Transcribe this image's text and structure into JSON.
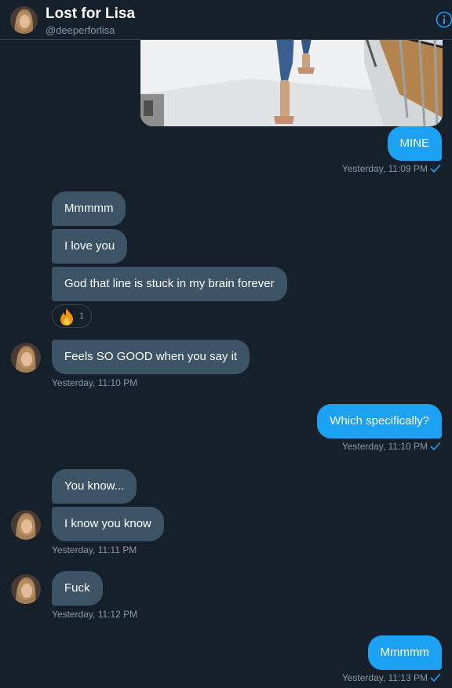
{
  "header": {
    "title": "Lost for Lisa",
    "handle": "@deeperforlisa",
    "info_icon": "info-icon"
  },
  "colors": {
    "background": "#15202b",
    "incoming_bubble": "#3d5466",
    "outgoing_bubble": "#1da1f2",
    "timestamp": "#8899a6",
    "read_check": "#1da1f2"
  },
  "messages": [
    {
      "dir": "out",
      "text": "MINE",
      "timestamp": "Yesterday, 11:09 PM"
    },
    {
      "dir": "in",
      "text": "Mmmmm"
    },
    {
      "dir": "in",
      "text": "I love you"
    },
    {
      "dir": "in",
      "text": "God that line is stuck in my brain forever",
      "reaction": {
        "emoji": "fire",
        "count": "1"
      }
    },
    {
      "dir": "in",
      "text": "Feels SO GOOD when you say it",
      "timestamp": "Yesterday, 11:10 PM"
    },
    {
      "dir": "out",
      "text": "Which specifically?",
      "timestamp": "Yesterday, 11:10 PM"
    },
    {
      "dir": "in",
      "text": "You know..."
    },
    {
      "dir": "in",
      "text": "I know you know",
      "timestamp": "Yesterday, 11:11 PM"
    },
    {
      "dir": "in",
      "text": "Fuck",
      "timestamp": "Yesterday, 11:12 PM"
    },
    {
      "dir": "out",
      "text": "Mmmmm",
      "timestamp": "Yesterday, 11:13 PM"
    }
  ]
}
